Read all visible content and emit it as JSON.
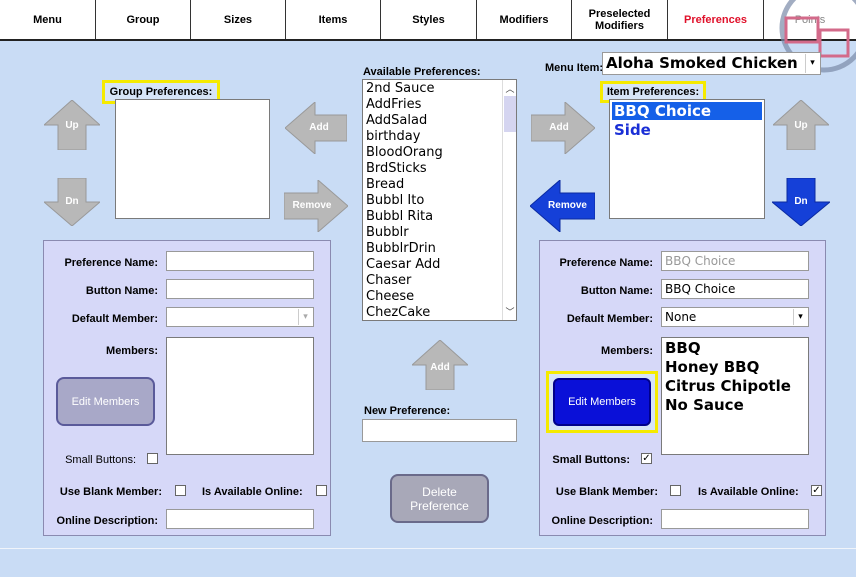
{
  "tabs": [
    "Menu",
    "Group",
    "Sizes",
    "Items",
    "Styles",
    "Modifiers",
    "Preselected Modifiers",
    "Preferences",
    "Points"
  ],
  "group_prefs": {
    "label": "Group Preferences:"
  },
  "available": {
    "label": "Available Preferences:",
    "items": [
      "2nd Sauce",
      "AddFries",
      "AddSalad",
      "birthday",
      "BloodOrang",
      "BrdSticks",
      "Bread",
      "Bubbl Ito",
      "Bubbl Rita",
      "Bubblr",
      "BubblrDrin",
      "Caesar Add",
      "Chaser",
      "Cheese",
      "ChezCake"
    ]
  },
  "menu_item": {
    "label": "Menu Item:",
    "value": "Aloha Smoked Chicken"
  },
  "item_prefs": {
    "label": "Item Preferences:",
    "items": [
      "BBQ Choice",
      "Side"
    ]
  },
  "buttons": {
    "up": "Up",
    "dn": "Dn",
    "add": "Add",
    "remove": "Remove",
    "edit_members": "Edit Members",
    "delete_pref": "Delete Preference"
  },
  "new_pref": {
    "label": "New Preference:",
    "value": ""
  },
  "left_form": {
    "pref_name_label": "Preference Name:",
    "button_name_label": "Button Name:",
    "default_member_label": "Default Member:",
    "members_label": "Members:",
    "small_buttons_label": "Small Buttons:",
    "use_blank_label": "Use Blank Member:",
    "available_online_label": "Is Available Online:",
    "online_desc_label": "Online Description:"
  },
  "right_form": {
    "pref_name_label": "Preference Name:",
    "pref_name_value": "BBQ Choice",
    "button_name_label": "Button Name:",
    "button_name_value": "BBQ Choice",
    "default_member_label": "Default Member:",
    "default_member_value": "None",
    "members_label": "Members:",
    "members": [
      "BBQ",
      "Honey BBQ",
      "Citrus Chipotle",
      "No Sauce"
    ],
    "small_buttons_label": "Small Buttons:",
    "use_blank_label": "Use Blank Member:",
    "available_online_label": "Is Available Online:",
    "online_desc_label": "Online Description:",
    "small_buttons_checked": "✓",
    "use_blank_checked": "",
    "available_online_checked": "✓"
  }
}
